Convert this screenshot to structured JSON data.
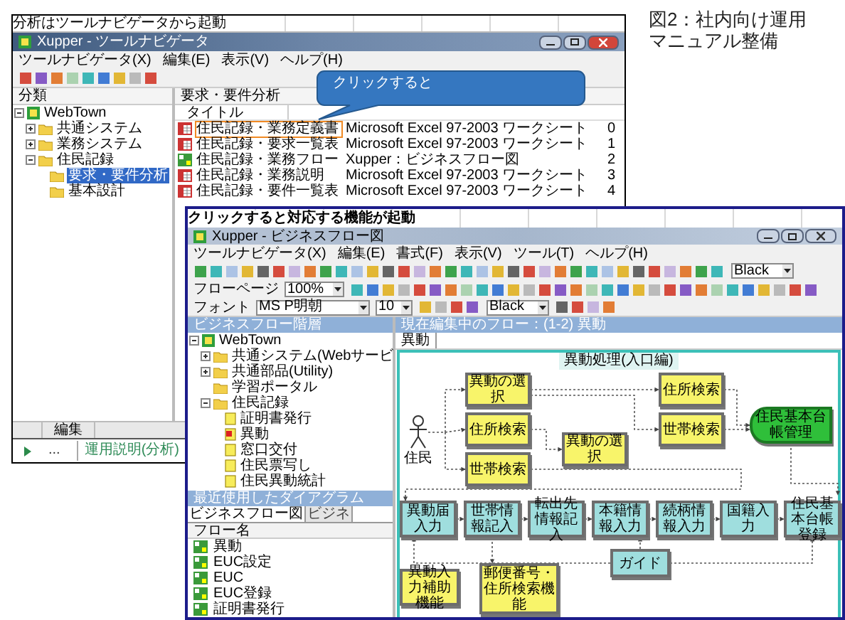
{
  "caption": [
    "図2：社内向け運用",
    "マニュアル整備"
  ],
  "navigator": {
    "banner": "分析はツールナビゲータから起動",
    "title": "Xupper - ツールナビゲータ",
    "menu": [
      "ツールナビゲータ(X)",
      "編集(E)",
      "表示(V)",
      "ヘルプ(H)"
    ],
    "tree_header": "分類",
    "tree": [
      {
        "label": "WebTown",
        "kind": "root",
        "selected": false,
        "expanded": true,
        "children": [
          {
            "label": "共通システム",
            "kind": "folder",
            "selected": false,
            "expanded": false
          },
          {
            "label": "業務システム",
            "kind": "folder",
            "selected": false,
            "expanded": false
          },
          {
            "label": "住民記録",
            "kind": "folder",
            "selected": false,
            "expanded": true,
            "children": [
              {
                "label": "要求・要件分析",
                "kind": "folder",
                "selected": true
              },
              {
                "label": "基本設計",
                "kind": "folder",
                "selected": false
              }
            ]
          }
        ]
      }
    ],
    "list_header": "要求・要件分析",
    "columns": [
      "タイトル"
    ],
    "rows": [
      {
        "title": "住民記録・業務定義書",
        "kind": "excel",
        "type": "Microsoft Excel 97-2003 ワークシート",
        "number": "0",
        "highlighted": true
      },
      {
        "title": "住民記録・要求一覧表",
        "kind": "excel",
        "type": "Microsoft Excel 97-2003 ワークシート",
        "number": "1",
        "highlighted": false
      },
      {
        "title": "住民記録・業務フロー",
        "kind": "flow",
        "type": "Xupper：ビジネスフロー図",
        "number": "2",
        "highlighted": false
      },
      {
        "title": "住民記録・業務説明",
        "kind": "excel",
        "type": "Microsoft Excel 97-2003 ワークシート",
        "number": "3",
        "highlighted": false
      },
      {
        "title": "住民記録・要件一覧表",
        "kind": "excel",
        "type": "Microsoft Excel 97-2003 ワークシート",
        "number": "4",
        "highlighted": false
      }
    ],
    "bottom_tab": "編集",
    "sheet_tabs": [
      {
        "label": "...",
        "selected": false
      },
      {
        "label": "運用説明(分析)",
        "selected": true
      }
    ]
  },
  "callout": {
    "text": "クリックすると"
  },
  "flow_window": {
    "banner": "クリックすると対応する機能が起動",
    "title": "Xupper - ビジネスフロー図",
    "menu": [
      "ツールナビゲータ(X)",
      "編集(E)",
      "書式(F)",
      "表示(V)",
      "ツール(T)",
      "ヘルプ(H)"
    ],
    "toolbar": {
      "color_1": "Black",
      "page_label": "フローページ",
      "zoom": "100%",
      "font_label": "フォント",
      "font": "MS P明朝",
      "size": "10",
      "color_2": "Black"
    },
    "tree_header": "ビジネスフロー階層",
    "tree": [
      {
        "label": "WebTown",
        "kind": "root",
        "selected": false,
        "expanded": true,
        "children": [
          {
            "label": "共通システム(Webサービ",
            "kind": "folder",
            "selected": false,
            "expanded": false
          },
          {
            "label": "共通部品(Utility)",
            "kind": "folder",
            "selected": false,
            "expanded": false
          },
          {
            "label": "学習ポータル",
            "kind": "folder",
            "selected": false
          },
          {
            "label": "住民記録",
            "kind": "folder",
            "selected": false,
            "expanded": true,
            "children": [
              {
                "label": "証明書発行",
                "kind": "flow",
                "selected": false
              },
              {
                "label": "異動",
                "kind": "flow-open",
                "selected": false
              },
              {
                "label": "窓口交付",
                "kind": "flow",
                "selected": false
              },
              {
                "label": "住民票写し",
                "kind": "flow",
                "selected": false
              },
              {
                "label": "住民異動統計",
                "kind": "flow",
                "selected": false
              }
            ]
          }
        ]
      }
    ],
    "recent_header": "最近使用したダイアグラム",
    "recent_tabs": [
      {
        "label": "ビジネスフロー図",
        "selected": true
      },
      {
        "label": "ビジネ",
        "selected": false
      }
    ],
    "recent_column": "フロー名",
    "recent": [
      "異動",
      "EUC設定",
      "EUC",
      "EUC登録",
      "証明書発行"
    ],
    "editing": "現在編集中のフロー：(1-2) 異動",
    "diagram_tab": "異動",
    "diagram_title": "異動処理(入口編)",
    "actor": "住民",
    "nodes": [
      {
        "label": "異動の選択",
        "kind": "task"
      },
      {
        "label": "住所検索",
        "kind": "task"
      },
      {
        "label": "世帯検索",
        "kind": "task"
      },
      {
        "label": "異動の選択",
        "kind": "task"
      },
      {
        "label": "住所検索",
        "kind": "task"
      },
      {
        "label": "世帯検索",
        "kind": "task"
      },
      {
        "label": "住民基本台帳管理",
        "kind": "hub"
      },
      {
        "label": "異動届入力",
        "kind": "screen"
      },
      {
        "label": "世帯情報記入",
        "kind": "screen"
      },
      {
        "label": "転出先情報記入",
        "kind": "screen"
      },
      {
        "label": "本籍情報入力",
        "kind": "screen"
      },
      {
        "label": "続柄情報入力",
        "kind": "screen"
      },
      {
        "label": "国籍入力",
        "kind": "screen"
      },
      {
        "label": "住民基本台帳登録",
        "kind": "screen"
      },
      {
        "label": "ガイド",
        "kind": "screen"
      },
      {
        "label": "異動入力補助機能",
        "kind": "task"
      },
      {
        "label": "郵便番号・住所検索機能",
        "kind": "task"
      }
    ]
  }
}
